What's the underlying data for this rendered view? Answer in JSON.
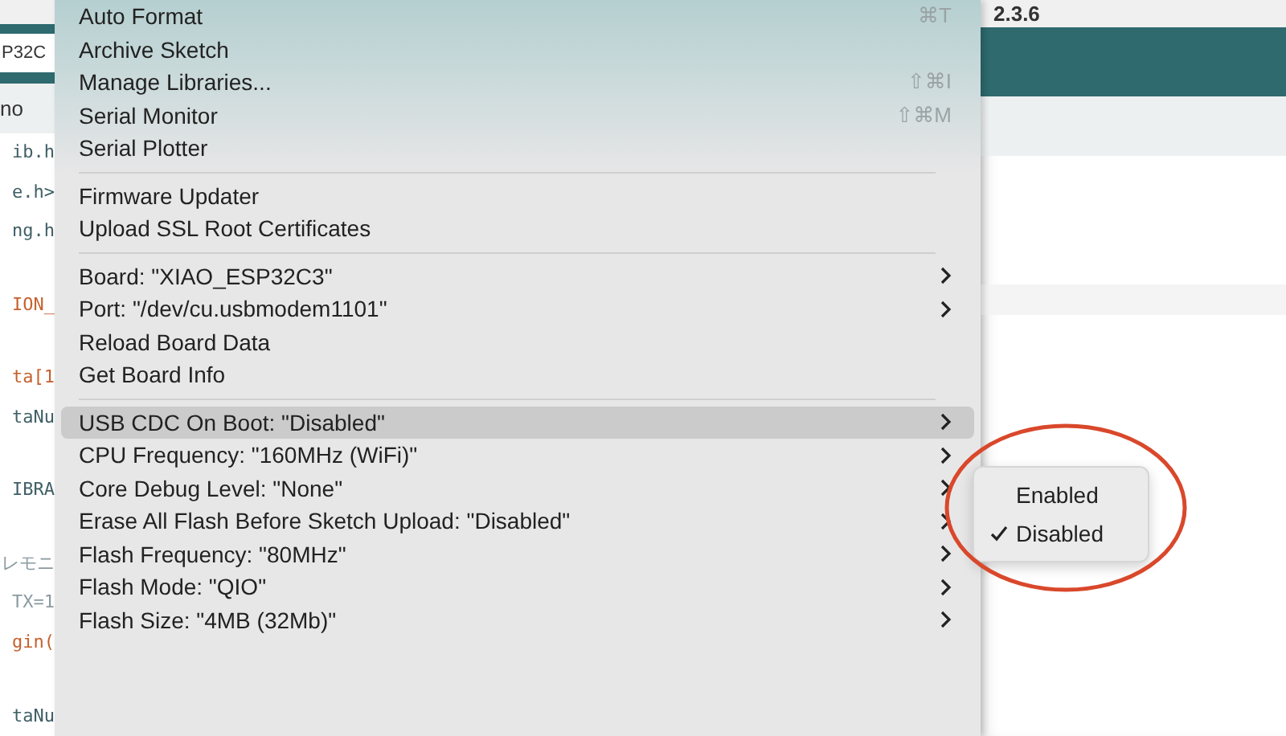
{
  "editor": {
    "version": "2.3.6",
    "board_selector": "P32C",
    "tab_label": "no",
    "code_lines": [
      {
        "text": "ib.h",
        "kind": "plain"
      },
      {
        "text": "e.h>",
        "kind": "plain"
      },
      {
        "text": "ng.h",
        "kind": "plain"
      },
      {
        "kind": "blank"
      },
      {
        "text": "ION_",
        "kind": "constant"
      },
      {
        "kind": "blank"
      },
      {
        "text": "ta[1",
        "kind": "keyword"
      },
      {
        "text": "taNu",
        "kind": "plain"
      },
      {
        "kind": "blank"
      },
      {
        "text": "IBRA",
        "kind": "plain"
      },
      {
        "kind": "blank"
      },
      {
        "text": "レモニ",
        "kind": "comment"
      },
      {
        "text": "TX=1",
        "kind": "comment"
      },
      {
        "text": "gin(",
        "kind": "constant"
      },
      {
        "kind": "blank"
      },
      {
        "text": "taNu",
        "kind": "plain"
      }
    ]
  },
  "menu": {
    "items": [
      {
        "kind": "item",
        "label": "Auto Format",
        "shortcut": "⌘T",
        "highlighted": false
      },
      {
        "kind": "item",
        "label": "Archive Sketch",
        "highlighted": false
      },
      {
        "kind": "item",
        "label": "Manage Libraries...",
        "shortcut": "⇧⌘I",
        "highlighted": false
      },
      {
        "kind": "item",
        "label": "Serial Monitor",
        "shortcut": "⇧⌘M",
        "highlighted": false
      },
      {
        "kind": "item",
        "label": "Serial Plotter",
        "highlighted": false
      },
      {
        "kind": "separator"
      },
      {
        "kind": "item",
        "label": "Firmware Updater",
        "highlighted": false
      },
      {
        "kind": "item",
        "label": "Upload SSL Root Certificates",
        "highlighted": false
      },
      {
        "kind": "separator"
      },
      {
        "kind": "submenu",
        "label": "Board: \"XIAO_ESP32C3\"",
        "highlighted": false
      },
      {
        "kind": "submenu",
        "label": "Port: \"/dev/cu.usbmodem1101\"",
        "highlighted": false
      },
      {
        "kind": "item",
        "label": "Reload Board Data",
        "highlighted": false
      },
      {
        "kind": "item",
        "label": "Get Board Info",
        "highlighted": false
      },
      {
        "kind": "separator"
      },
      {
        "kind": "submenu",
        "label": "USB CDC On Boot: \"Disabled\"",
        "highlighted": true
      },
      {
        "kind": "submenu",
        "label": "CPU Frequency: \"160MHz (WiFi)\"",
        "highlighted": false
      },
      {
        "kind": "submenu",
        "label": "Core Debug Level: \"None\"",
        "highlighted": false
      },
      {
        "kind": "submenu",
        "label": "Erase All Flash Before Sketch Upload: \"Disabled\"",
        "highlighted": false
      },
      {
        "kind": "submenu",
        "label": "Flash Frequency: \"80MHz\"",
        "highlighted": false
      },
      {
        "kind": "submenu",
        "label": "Flash Mode: \"QIO\"",
        "highlighted": false
      },
      {
        "kind": "submenu",
        "label": "Flash Size: \"4MB (32Mb)\"",
        "highlighted": false
      }
    ]
  },
  "submenu": {
    "options": [
      {
        "label": "Enabled",
        "selected": false
      },
      {
        "label": "Disabled",
        "selected": true
      }
    ]
  }
}
